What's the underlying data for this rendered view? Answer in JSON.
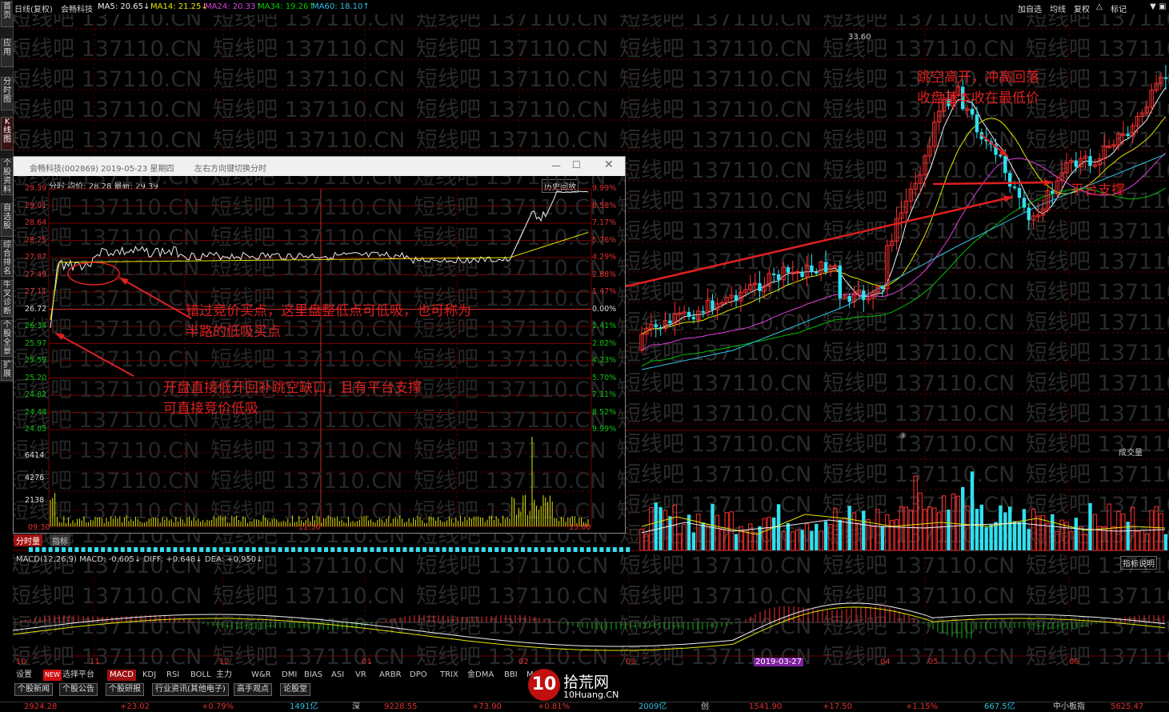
{
  "left_tabs": [
    "首页",
    "应用",
    "分时图",
    "K线图",
    "个股资料",
    "自选股",
    "综合排名",
    "牛叉诊断",
    "个股全景",
    "扩展"
  ],
  "top_indicators": [
    {
      "text": "日线(复权)",
      "color": "#d0d0d0"
    },
    {
      "text": "会畅科技",
      "color": "#d0d0d0"
    },
    {
      "text": "MA5: 20.65↓",
      "color": "#f0f0f0"
    },
    {
      "text": "MA14: 21.25↓",
      "color": "#e6e600"
    },
    {
      "text": "MA24: 20.33↑",
      "color": "#e040e0"
    },
    {
      "text": "MA34: 19.26↑",
      "color": "#00d000"
    },
    {
      "text": "MA60: 18.10↑",
      "color": "#30c0e0"
    }
  ],
  "top_right_buttons": [
    "加自选",
    "均线",
    "复权",
    "△",
    "标记",
    "▣"
  ],
  "main_chart": {
    "high_label": "33.60",
    "marker_label": "⑨",
    "date_highlight": "2019-03-27",
    "x_ticks": [
      "10",
      "11",
      "12",
      "01",
      "02",
      "03",
      "04",
      "05",
      "06"
    ],
    "volume_label": "成交量",
    "indicator_button": "指标说明"
  },
  "popup": {
    "title": "会畅科技(002869) 2019-05-23 星期四",
    "hint": "左右方向键切换分时",
    "header": "分时  均价: 28.28  最新: 29.39",
    "history_button": "历史回放",
    "y_left": [
      "29.39",
      "29.01",
      "28.64",
      "28.25",
      "27.87",
      "27.49",
      "27.11",
      "26.72",
      "26.34",
      "25.97",
      "25.59",
      "25.20",
      "24.82",
      "24.44",
      "24.05"
    ],
    "y_right": [
      "9.99%",
      "8.58%",
      "7.17%",
      "5.76%",
      "4.29%",
      "2.88%",
      "1.47%",
      "0.00%",
      "1.41%",
      "2.82%",
      "4.23%",
      "5.70%",
      "7.11%",
      "8.52%",
      "9.99%"
    ],
    "vol_left": [
      "6414",
      "4276",
      "2138"
    ],
    "time_labels": [
      "09:30",
      "11:30",
      "15:00"
    ],
    "tabs": [
      "分时量",
      "指标"
    ]
  },
  "annotations": {
    "a1": [
      "跳空高开，冲高回落",
      "收盘基本收在最低价"
    ],
    "a2": "平台支撑",
    "a3": [
      "错过竞价买点，这里盘整低点可低吸，也可称为",
      "半路的低吸买点"
    ],
    "a4": [
      "开盘直接低开回补跳空缺口，且有平台支撑",
      "可直接竞价低吸"
    ]
  },
  "watermark": "短线吧 137110.CN",
  "macd_header": "MACD(12,26,9)  MACD: -0.605↓  DIFF: +0.648↓  DEA: +0.950↓",
  "bottom_tabs": [
    "设置",
    "NEW",
    "选择平台",
    "MACD",
    "KDJ",
    "RSI",
    "BOLL",
    "主力",
    "W&R",
    "DMI",
    "BIAS",
    "ASI",
    "VR",
    "ARBR",
    "DPO",
    "TRIX",
    "金DMA",
    "BBI",
    "MA"
  ],
  "bottom_buttons": [
    "个股新闻",
    "个股公告",
    "个股研报",
    "行业资讯(其他电子)",
    "高手观点",
    "论股堂"
  ],
  "logo": {
    "main": "拾荒网",
    "sub": "10Huang.CN"
  },
  "status": [
    {
      "text": "2924.28",
      "color": "#e03030"
    },
    {
      "text": "+23.02",
      "color": "#e03030"
    },
    {
      "text": "+0.79%",
      "color": "#e03030"
    },
    {
      "text": "1491亿",
      "color": "#30c0e0"
    },
    {
      "text": "深",
      "color": "#ccc"
    },
    {
      "text": "9228.55",
      "color": "#e03030"
    },
    {
      "text": "+73.90",
      "color": "#e03030"
    },
    {
      "text": "+0.81%",
      "color": "#e03030"
    },
    {
      "text": "2009亿",
      "color": "#30c0e0"
    },
    {
      "text": "创",
      "color": "#ccc"
    },
    {
      "text": "1541.90",
      "color": "#e03030"
    },
    {
      "text": "+17.50",
      "color": "#e03030"
    },
    {
      "text": "+1.15%",
      "color": "#e03030"
    },
    {
      "text": "667.5亿",
      "color": "#30c0e0"
    },
    {
      "text": "中小板指",
      "color": "#ccc"
    },
    {
      "text": "5625.47",
      "color": "#e03030"
    }
  ]
}
